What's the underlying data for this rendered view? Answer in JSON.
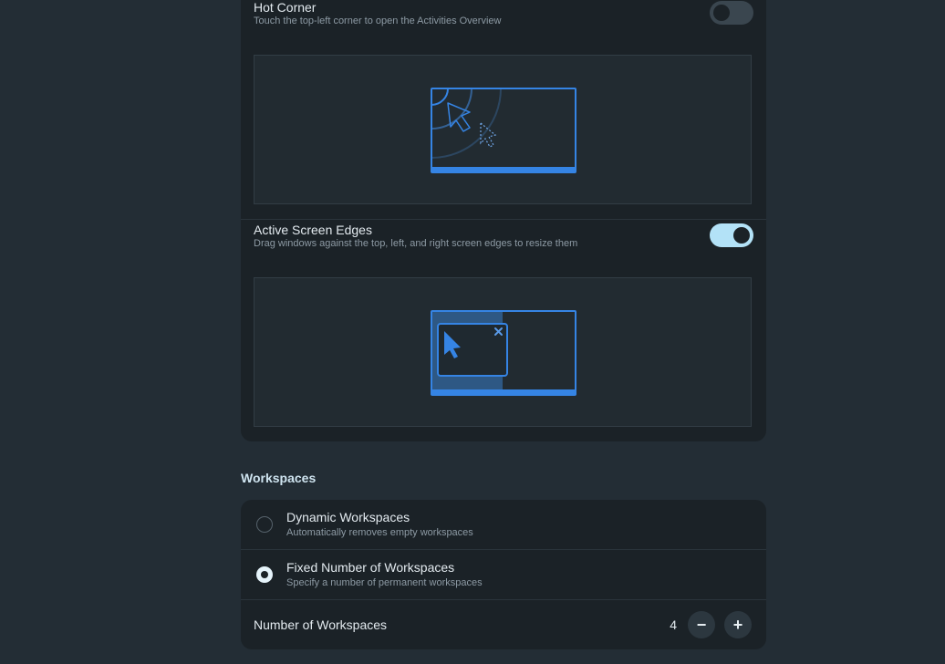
{
  "hot_corner": {
    "title": "Hot Corner",
    "subtitle": "Touch the top-left corner to open the Activities Overview",
    "enabled": false
  },
  "active_edges": {
    "title": "Active Screen Edges",
    "subtitle": "Drag windows against the top, left, and right screen edges to resize them",
    "enabled": true
  },
  "workspaces": {
    "section_title": "Workspaces",
    "options": [
      {
        "title": "Dynamic Workspaces",
        "subtitle": "Automatically removes empty workspaces",
        "selected": false
      },
      {
        "title": "Fixed Number of Workspaces",
        "subtitle": "Specify a number of permanent workspaces",
        "selected": true
      }
    ],
    "number": {
      "label": "Number of Workspaces",
      "value": "4",
      "decrement_label": "−",
      "increment_label": "+"
    }
  },
  "colors": {
    "accent": "#3584e4",
    "card_bg": "#1b2227",
    "page_bg": "#232d35",
    "switch_on": "#b3e2f7"
  }
}
